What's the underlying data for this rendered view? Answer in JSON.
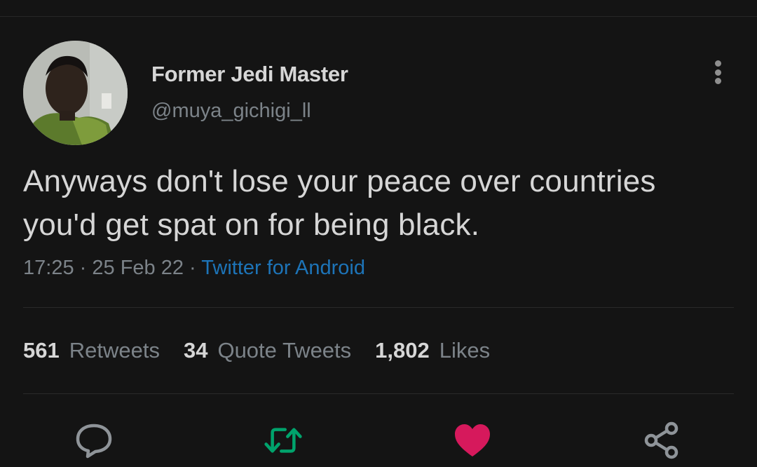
{
  "tweet": {
    "author": {
      "display_name": "Former Jedi Master",
      "handle": "@muya_gichigi_ll"
    },
    "text_line1": "Anyways don't lose your peace over countries",
    "text_line2": "you'd get spat on for being black.",
    "time": "17:25",
    "date": "25 Feb 22",
    "separator": "·",
    "source": "Twitter for Android"
  },
  "stats": {
    "retweets_count": "561",
    "retweets_label": "Retweets",
    "quotes_count": "34",
    "quotes_label": "Quote Tweets",
    "likes_count": "1,802",
    "likes_label": "Likes"
  },
  "actions": {
    "reply_icon": "speech-bubble-icon",
    "retweet_icon": "retweet-arrows-icon",
    "like_icon": "heart-icon",
    "share_icon": "share-nodes-icon"
  },
  "colors": {
    "background": "#141414",
    "link": "#1d74b8",
    "retweet_active": "#00a36c",
    "like_active": "#d6195c",
    "muted": "#7c8389"
  }
}
